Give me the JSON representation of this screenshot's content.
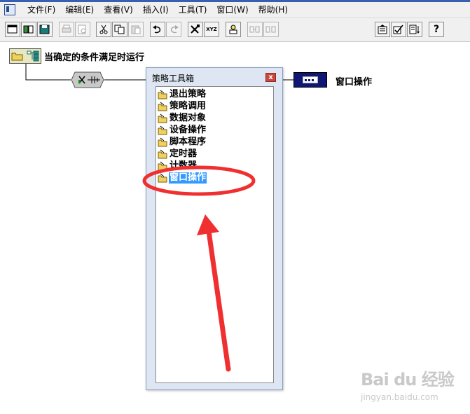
{
  "menubar": {
    "items": [
      "文件(F)",
      "编辑(E)",
      "查看(V)",
      "插入(I)",
      "工具(T)",
      "窗口(W)",
      "帮助(H)"
    ]
  },
  "toolbar": {
    "buttons": [
      {
        "icon": "new-window-icon",
        "enabled": true
      },
      {
        "icon": "open-icon",
        "enabled": true
      },
      {
        "icon": "save-icon",
        "enabled": true
      },
      {
        "icon": "print-icon",
        "enabled": false
      },
      {
        "icon": "print-preview-icon",
        "enabled": false
      },
      {
        "icon": "cut-icon",
        "enabled": true
      },
      {
        "icon": "copy-icon",
        "enabled": true
      },
      {
        "icon": "paste-icon",
        "enabled": false
      },
      {
        "icon": "undo-icon",
        "enabled": true
      },
      {
        "icon": "redo-icon",
        "enabled": false
      },
      {
        "icon": "tools-icon",
        "enabled": true
      },
      {
        "icon": "xyz-icon",
        "label": "XYZ",
        "enabled": true
      },
      {
        "icon": "strategy-icon",
        "enabled": true
      },
      {
        "icon": "grid-icon",
        "enabled": false
      },
      {
        "icon": "grid2-icon",
        "enabled": false
      },
      {
        "icon": "properties-icon",
        "enabled": true
      },
      {
        "icon": "check-icon",
        "enabled": true
      },
      {
        "icon": "sort-icon",
        "enabled": true
      },
      {
        "icon": "help-icon",
        "label": "?",
        "enabled": true
      }
    ]
  },
  "canvas": {
    "root_label": "当确定的条件满足时运行",
    "action_label": "窗口操作"
  },
  "toolbox": {
    "title": "策略工具箱",
    "close_label": "x",
    "items": [
      {
        "label": "退出策略",
        "selected": false
      },
      {
        "label": "策略调用",
        "selected": false
      },
      {
        "label": "数据对象",
        "selected": false
      },
      {
        "label": "设备操作",
        "selected": false
      },
      {
        "label": "脚本程序",
        "selected": false
      },
      {
        "label": "定时器",
        "selected": false
      },
      {
        "label": "计数器",
        "selected": false
      },
      {
        "label": "窗口操作",
        "selected": true
      }
    ]
  },
  "watermark": {
    "brand": "Bai du 经验",
    "url": "jingyan.baidu.com"
  },
  "colors": {
    "selection": "#3399ff",
    "annotation": "#f03030",
    "window_node": "#0f1775"
  }
}
